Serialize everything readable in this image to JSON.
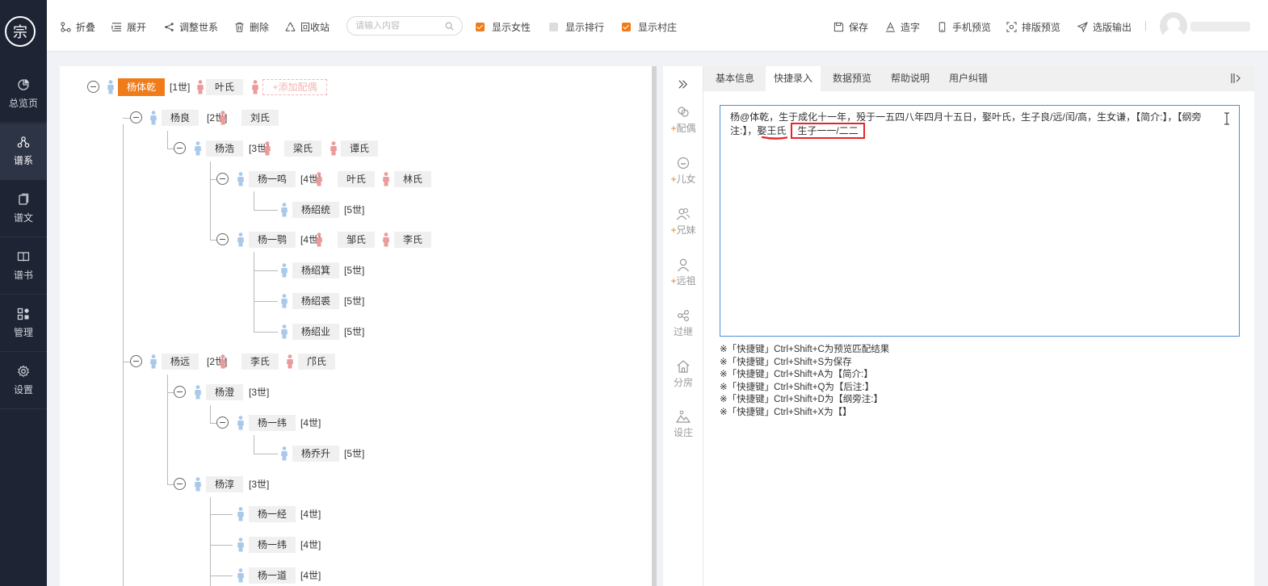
{
  "logo": {
    "glyph": "宗"
  },
  "sidebar": {
    "items": [
      {
        "label": "总览页",
        "icon": "pie-chart-icon"
      },
      {
        "label": "谱系",
        "icon": "family-tree-icon"
      },
      {
        "label": "谱文",
        "icon": "document-icon"
      },
      {
        "label": "谱书",
        "icon": "book-icon"
      },
      {
        "label": "管理",
        "icon": "grid-icon"
      },
      {
        "label": "设置",
        "icon": "gear-icon"
      }
    ],
    "active_index": 1
  },
  "toolbar": {
    "fold": "折叠",
    "expand": "展开",
    "adjust": "调整世系",
    "delete": "删除",
    "recycle": "回收站",
    "search_placeholder": "请输入内容",
    "show_female": "显示女性",
    "show_female_checked": true,
    "show_rank": "显示排行",
    "show_rank_checked": false,
    "show_village": "显示村庄",
    "show_village_checked": true,
    "save": "保存",
    "make_char": "造字",
    "mobile_preview": "手机预览",
    "layout_preview": "排版预览",
    "export": "选版输出"
  },
  "colors": {
    "accent": "#f07c19",
    "male": "#a9c9ea",
    "female": "#ec9a9a",
    "nav_bg": "#1e2433",
    "highlight": "#e8242a"
  },
  "tree": {
    "add_spouse": "+添加配偶",
    "nodes": [
      {
        "name": "杨体乾",
        "gen": "[1世]",
        "spouses": [
          "叶氏"
        ],
        "root": true
      },
      {
        "name": "杨良",
        "gen": "[2世]",
        "spouses": [
          "刘氏"
        ]
      },
      {
        "name": "杨浩",
        "gen": "[3世]",
        "spouses": [
          "梁氏",
          "谭氏"
        ]
      },
      {
        "name": "杨一鸣",
        "gen": "[4世]",
        "spouses": [
          "叶氏",
          "林氏"
        ]
      },
      {
        "name": "杨绍统",
        "gen": "[5世]",
        "spouses": []
      },
      {
        "name": "杨一鹗",
        "gen": "[4世]",
        "spouses": [
          "邹氏",
          "李氏"
        ]
      },
      {
        "name": "杨绍箕",
        "gen": "[5世]",
        "spouses": []
      },
      {
        "name": "杨绍裘",
        "gen": "[5世]",
        "spouses": []
      },
      {
        "name": "杨绍业",
        "gen": "[5世]",
        "spouses": []
      },
      {
        "name": "杨远",
        "gen": "[2世]",
        "spouses": [
          "李氏",
          "邝氏"
        ]
      },
      {
        "name": "杨澄",
        "gen": "[3世]",
        "spouses": []
      },
      {
        "name": "杨一纬",
        "gen": "[4世]",
        "spouses": []
      },
      {
        "name": "杨乔升",
        "gen": "[5世]",
        "spouses": []
      },
      {
        "name": "杨淳",
        "gen": "[3世]",
        "spouses": []
      },
      {
        "name": "杨一经",
        "gen": "[4世]",
        "spouses": []
      },
      {
        "name": "杨一纬",
        "gen": "[4世]",
        "spouses": []
      },
      {
        "name": "杨一道",
        "gen": "[4世]",
        "spouses": []
      }
    ]
  },
  "tools": [
    {
      "label": "配偶",
      "plus": true,
      "icon": "spouse-icon"
    },
    {
      "label": "儿女",
      "plus": true,
      "icon": "child-icon"
    },
    {
      "label": "兄妹",
      "plus": true,
      "icon": "siblings-icon"
    },
    {
      "label": "远祖",
      "plus": true,
      "icon": "ancestor-icon"
    },
    {
      "label": "过继",
      "plus": false,
      "icon": "adopt-icon"
    },
    {
      "label": "分房",
      "plus": false,
      "icon": "house-icon"
    },
    {
      "label": "设庄",
      "plus": false,
      "icon": "village-icon"
    }
  ],
  "tabs": [
    "基本信息",
    "快捷录入",
    "数据预览",
    "帮助说明",
    "用户纠错"
  ],
  "active_tab": 1,
  "editor": {
    "line1": "杨@体乾，生于成化十一年，殁于一五四八年四月十五日，娶叶氏，生子良/远/闰/高，生女谦，【简介:】，【纲旁",
    "line2_a": "注:】，",
    "line2_b": "娶王氏",
    "line2_c": "生子一一/二二"
  },
  "hints": [
    "※「快捷键」Ctrl+Shift+C为预览匹配结果",
    "※「快捷键」Ctrl+Shift+S为保存",
    "※「快捷键」Ctrl+Shift+A为【简介:】",
    "※「快捷键」Ctrl+Shift+Q为【后注:】",
    "※「快捷键」Ctrl+Shift+D为【纲旁注:】",
    "※「快捷键」Ctrl+Shift+X为【】"
  ]
}
